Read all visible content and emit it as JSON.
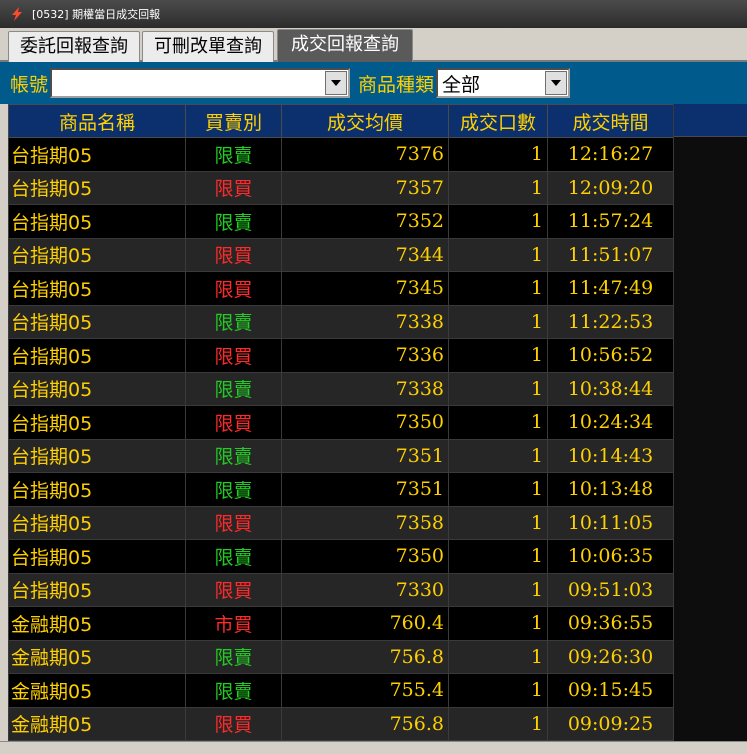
{
  "window": {
    "title": "[0532] 期權當日成交回報"
  },
  "tabs": [
    {
      "label": "委託回報查詢",
      "active": false
    },
    {
      "label": "可刪改單查詢",
      "active": false
    },
    {
      "label": "成交回報查詢",
      "active": true
    }
  ],
  "filters": {
    "account_label": "帳號",
    "account_value": "",
    "category_label": "商品種類",
    "category_value": "全部"
  },
  "columns": [
    "商品名稱",
    "買賣別",
    "成交均價",
    "成交口數",
    "成交時間"
  ],
  "colors": {
    "buy": "#ff2a2a",
    "sell": "#22cc22",
    "text": "#ffd000",
    "header_bg": "#0c2f6e",
    "filter_bg": "#005a8c"
  },
  "rows": [
    {
      "name": "台指期05",
      "side": "限賣",
      "price": "7376",
      "qty": "1",
      "time": "12:16:27"
    },
    {
      "name": "台指期05",
      "side": "限買",
      "price": "7357",
      "qty": "1",
      "time": "12:09:20"
    },
    {
      "name": "台指期05",
      "side": "限賣",
      "price": "7352",
      "qty": "1",
      "time": "11:57:24"
    },
    {
      "name": "台指期05",
      "side": "限買",
      "price": "7344",
      "qty": "1",
      "time": "11:51:07"
    },
    {
      "name": "台指期05",
      "side": "限買",
      "price": "7345",
      "qty": "1",
      "time": "11:47:49"
    },
    {
      "name": "台指期05",
      "side": "限賣",
      "price": "7338",
      "qty": "1",
      "time": "11:22:53"
    },
    {
      "name": "台指期05",
      "side": "限買",
      "price": "7336",
      "qty": "1",
      "time": "10:56:52"
    },
    {
      "name": "台指期05",
      "side": "限賣",
      "price": "7338",
      "qty": "1",
      "time": "10:38:44"
    },
    {
      "name": "台指期05",
      "side": "限買",
      "price": "7350",
      "qty": "1",
      "time": "10:24:34"
    },
    {
      "name": "台指期05",
      "side": "限賣",
      "price": "7351",
      "qty": "1",
      "time": "10:14:43"
    },
    {
      "name": "台指期05",
      "side": "限賣",
      "price": "7351",
      "qty": "1",
      "time": "10:13:48"
    },
    {
      "name": "台指期05",
      "side": "限買",
      "price": "7358",
      "qty": "1",
      "time": "10:11:05"
    },
    {
      "name": "台指期05",
      "side": "限賣",
      "price": "7350",
      "qty": "1",
      "time": "10:06:35"
    },
    {
      "name": "台指期05",
      "side": "限買",
      "price": "7330",
      "qty": "1",
      "time": "09:51:03"
    },
    {
      "name": "金融期05",
      "side": "市買",
      "price": "760.4",
      "qty": "1",
      "time": "09:36:55"
    },
    {
      "name": "金融期05",
      "side": "限賣",
      "price": "756.8",
      "qty": "1",
      "time": "09:26:30"
    },
    {
      "name": "金融期05",
      "side": "限賣",
      "price": "755.4",
      "qty": "1",
      "time": "09:15:45"
    },
    {
      "name": "金融期05",
      "side": "限買",
      "price": "756.8",
      "qty": "1",
      "time": "09:09:25"
    }
  ]
}
